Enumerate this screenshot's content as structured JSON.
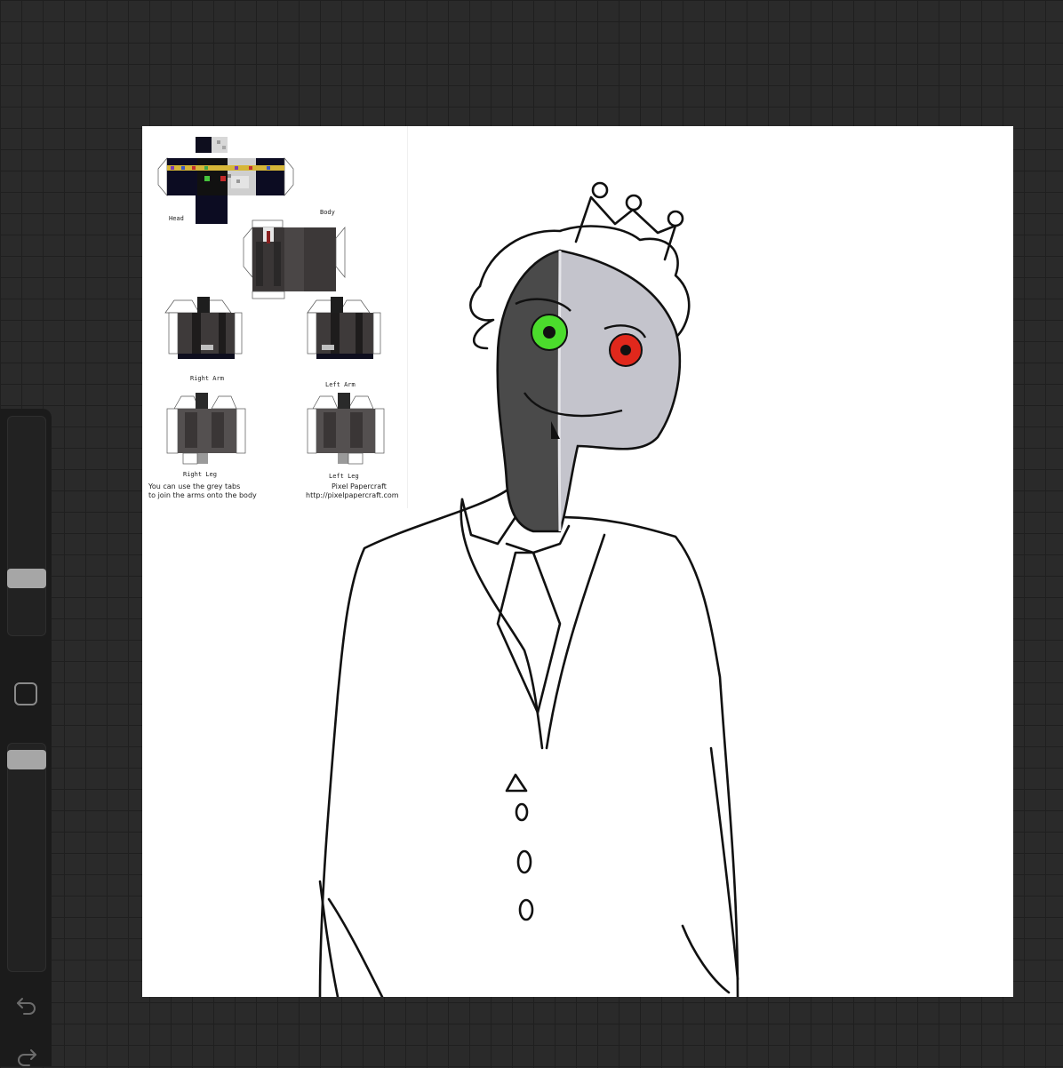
{
  "app": {
    "ui_colors": {
      "background": "#2a2a2a",
      "sidebar": "#1b1b1b",
      "canvas": "#ffffff",
      "thumb": "#a6a6a6"
    },
    "sidebar": {
      "brush_size_slider": {
        "label": "brush size",
        "value": 0.78
      },
      "opacity_slider": {
        "label": "opacity",
        "value": 0.0
      },
      "modifier_icon": "square-modifier-icon",
      "undo_icon": "undo-icon",
      "redo_icon": "redo-icon"
    }
  },
  "reference": {
    "labels": {
      "head": "Head",
      "body": "Body",
      "right_arm": "Right Arm",
      "left_arm": "Left Arm",
      "right_leg": "Right Leg",
      "left_leg": "Left Leg"
    },
    "note_line1": "You can use the grey tabs",
    "note_line2": "to join the arms onto the body",
    "credit_name": "Pixel Papercraft",
    "credit_url": "http://pixelpapercraft.com"
  },
  "artwork": {
    "left_eye_color": "#4bdc2c",
    "right_eye_color": "#e0281c",
    "dark_skin": "#4a4a4a",
    "light_skin": "#c4c4cc"
  }
}
